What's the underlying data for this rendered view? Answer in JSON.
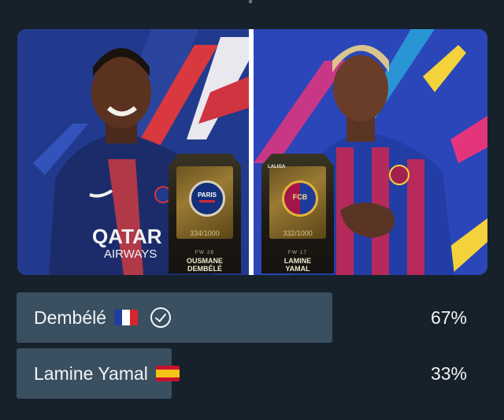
{
  "poll": {
    "options": [
      {
        "name": "Dembélé",
        "flag": "france-flag-icon",
        "selected": true,
        "percent_label": "67%",
        "share": 0.67
      },
      {
        "name": "Lamine Yamal",
        "flag": "spain-flag-icon",
        "selected": false,
        "percent_label": "33%",
        "share": 0.33
      }
    ]
  },
  "cards": {
    "left": {
      "serial": "334/1000",
      "meta": "FW  28",
      "name": "OUSMANE\nDEMBÉLÉ",
      "crest_text": "PARIS"
    },
    "right": {
      "tag": "LALIGA",
      "serial": "332/1000",
      "meta": "FW  17",
      "name": "LAMINE\nYAMAL",
      "crest_text": "FCB"
    }
  },
  "photos": {
    "left_caption": "QATAR AIRWAYS"
  },
  "colors": {
    "background": "#16212b",
    "bar": "#3a4f5f",
    "psg_blue": "#243a8f",
    "barca_blue": "#2c43b8"
  }
}
